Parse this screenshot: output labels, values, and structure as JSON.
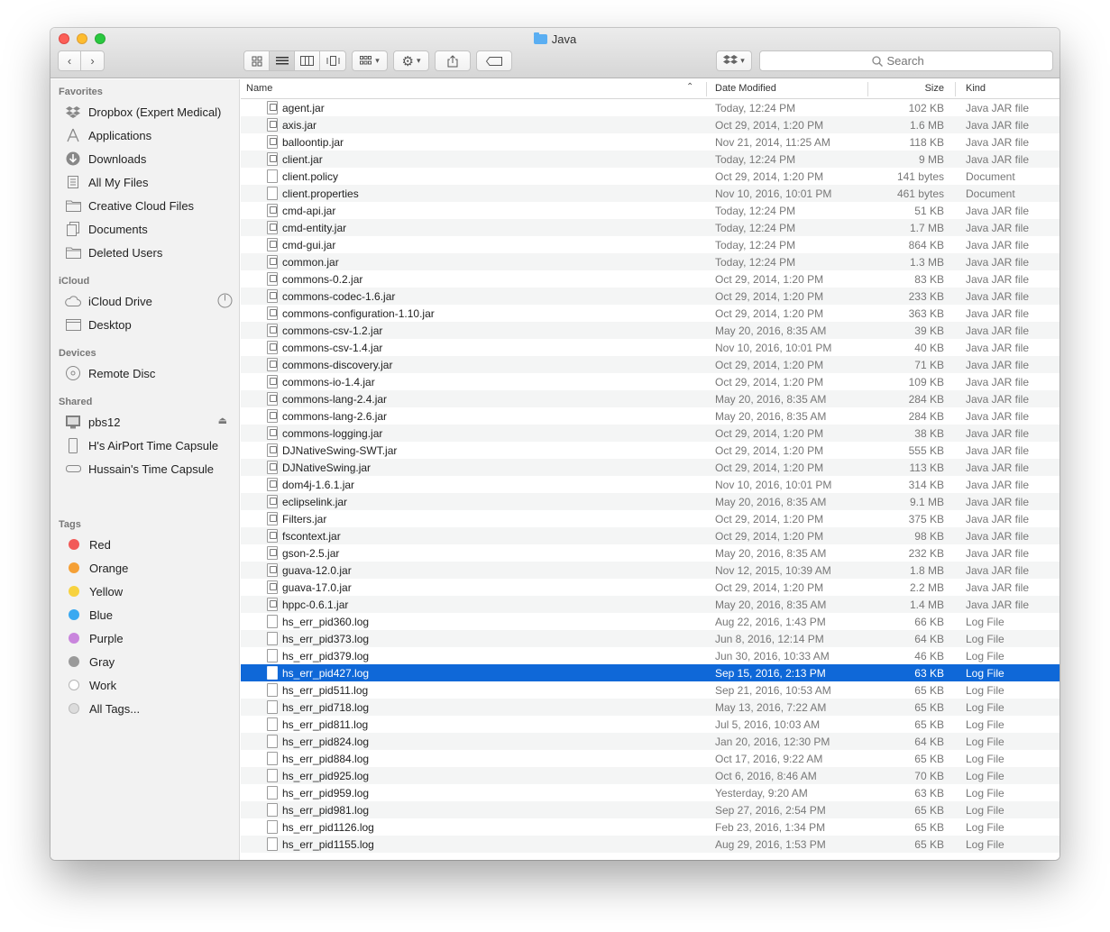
{
  "window": {
    "title": "Java"
  },
  "toolbar": {
    "search_placeholder": "Search"
  },
  "sidebar": {
    "favorites_heading": "Favorites",
    "favorites": [
      {
        "label": "Dropbox (Expert Medical)",
        "icon": "dropbox-icon"
      },
      {
        "label": "Applications",
        "icon": "applications-icon"
      },
      {
        "label": "Downloads",
        "icon": "downloads-icon"
      },
      {
        "label": "All My Files",
        "icon": "all-files-icon"
      },
      {
        "label": "Creative Cloud Files",
        "icon": "folder-icon"
      },
      {
        "label": "Documents",
        "icon": "documents-icon"
      },
      {
        "label": "Deleted Users",
        "icon": "folder-icon"
      }
    ],
    "icloud_heading": "iCloud",
    "icloud": [
      {
        "label": "iCloud Drive",
        "icon": "cloud-icon"
      },
      {
        "label": "Desktop",
        "icon": "desktop-icon"
      }
    ],
    "devices_heading": "Devices",
    "devices": [
      {
        "label": "Remote Disc",
        "icon": "disc-icon"
      }
    ],
    "shared_heading": "Shared",
    "shared": [
      {
        "label": "pbs12",
        "icon": "monitor-icon"
      },
      {
        "label": "H's AirPort Time Capsule",
        "icon": "time-capsule-icon"
      },
      {
        "label": "Hussain's Time Capsule",
        "icon": "time-capsule-icon"
      }
    ],
    "tags_heading": "Tags",
    "tags": [
      {
        "label": "Red",
        "color": "#f25a58"
      },
      {
        "label": "Orange",
        "color": "#f5a036"
      },
      {
        "label": "Yellow",
        "color": "#f7d23f"
      },
      {
        "label": "Blue",
        "color": "#3aa9f1"
      },
      {
        "label": "Purple",
        "color": "#c985dd"
      },
      {
        "label": "Gray",
        "color": "#9a9a9a"
      },
      {
        "label": "Work",
        "color": "#ffffff"
      },
      {
        "label": "All Tags...",
        "color": "#dcdcdc"
      }
    ]
  },
  "columns": {
    "name": "Name",
    "date": "Date Modified",
    "size": "Size",
    "kind": "Kind"
  },
  "files": [
    {
      "name": "agent.jar",
      "date": "Today, 12:24 PM",
      "size": "102 KB",
      "kind": "Java JAR file",
      "type": "jar"
    },
    {
      "name": "axis.jar",
      "date": "Oct 29, 2014, 1:20 PM",
      "size": "1.6 MB",
      "kind": "Java JAR file",
      "type": "jar"
    },
    {
      "name": "balloontip.jar",
      "date": "Nov 21, 2014, 11:25 AM",
      "size": "118 KB",
      "kind": "Java JAR file",
      "type": "jar"
    },
    {
      "name": "client.jar",
      "date": "Today, 12:24 PM",
      "size": "9 MB",
      "kind": "Java JAR file",
      "type": "jar"
    },
    {
      "name": "client.policy",
      "date": "Oct 29, 2014, 1:20 PM",
      "size": "141 bytes",
      "kind": "Document",
      "type": "doc"
    },
    {
      "name": "client.properties",
      "date": "Nov 10, 2016, 10:01 PM",
      "size": "461 bytes",
      "kind": "Document",
      "type": "doc"
    },
    {
      "name": "cmd-api.jar",
      "date": "Today, 12:24 PM",
      "size": "51 KB",
      "kind": "Java JAR file",
      "type": "jar"
    },
    {
      "name": "cmd-entity.jar",
      "date": "Today, 12:24 PM",
      "size": "1.7 MB",
      "kind": "Java JAR file",
      "type": "jar"
    },
    {
      "name": "cmd-gui.jar",
      "date": "Today, 12:24 PM",
      "size": "864 KB",
      "kind": "Java JAR file",
      "type": "jar"
    },
    {
      "name": "common.jar",
      "date": "Today, 12:24 PM",
      "size": "1.3 MB",
      "kind": "Java JAR file",
      "type": "jar"
    },
    {
      "name": "commons-0.2.jar",
      "date": "Oct 29, 2014, 1:20 PM",
      "size": "83 KB",
      "kind": "Java JAR file",
      "type": "jar"
    },
    {
      "name": "commons-codec-1.6.jar",
      "date": "Oct 29, 2014, 1:20 PM",
      "size": "233 KB",
      "kind": "Java JAR file",
      "type": "jar"
    },
    {
      "name": "commons-configuration-1.10.jar",
      "date": "Oct 29, 2014, 1:20 PM",
      "size": "363 KB",
      "kind": "Java JAR file",
      "type": "jar"
    },
    {
      "name": "commons-csv-1.2.jar",
      "date": "May 20, 2016, 8:35 AM",
      "size": "39 KB",
      "kind": "Java JAR file",
      "type": "jar"
    },
    {
      "name": "commons-csv-1.4.jar",
      "date": "Nov 10, 2016, 10:01 PM",
      "size": "40 KB",
      "kind": "Java JAR file",
      "type": "jar"
    },
    {
      "name": "commons-discovery.jar",
      "date": "Oct 29, 2014, 1:20 PM",
      "size": "71 KB",
      "kind": "Java JAR file",
      "type": "jar"
    },
    {
      "name": "commons-io-1.4.jar",
      "date": "Oct 29, 2014, 1:20 PM",
      "size": "109 KB",
      "kind": "Java JAR file",
      "type": "jar"
    },
    {
      "name": "commons-lang-2.4.jar",
      "date": "May 20, 2016, 8:35 AM",
      "size": "284 KB",
      "kind": "Java JAR file",
      "type": "jar"
    },
    {
      "name": "commons-lang-2.6.jar",
      "date": "May 20, 2016, 8:35 AM",
      "size": "284 KB",
      "kind": "Java JAR file",
      "type": "jar"
    },
    {
      "name": "commons-logging.jar",
      "date": "Oct 29, 2014, 1:20 PM",
      "size": "38 KB",
      "kind": "Java JAR file",
      "type": "jar"
    },
    {
      "name": "DJNativeSwing-SWT.jar",
      "date": "Oct 29, 2014, 1:20 PM",
      "size": "555 KB",
      "kind": "Java JAR file",
      "type": "jar"
    },
    {
      "name": "DJNativeSwing.jar",
      "date": "Oct 29, 2014, 1:20 PM",
      "size": "113 KB",
      "kind": "Java JAR file",
      "type": "jar"
    },
    {
      "name": "dom4j-1.6.1.jar",
      "date": "Nov 10, 2016, 10:01 PM",
      "size": "314 KB",
      "kind": "Java JAR file",
      "type": "jar"
    },
    {
      "name": "eclipselink.jar",
      "date": "May 20, 2016, 8:35 AM",
      "size": "9.1 MB",
      "kind": "Java JAR file",
      "type": "jar"
    },
    {
      "name": "Filters.jar",
      "date": "Oct 29, 2014, 1:20 PM",
      "size": "375 KB",
      "kind": "Java JAR file",
      "type": "jar"
    },
    {
      "name": "fscontext.jar",
      "date": "Oct 29, 2014, 1:20 PM",
      "size": "98 KB",
      "kind": "Java JAR file",
      "type": "jar"
    },
    {
      "name": "gson-2.5.jar",
      "date": "May 20, 2016, 8:35 AM",
      "size": "232 KB",
      "kind": "Java JAR file",
      "type": "jar"
    },
    {
      "name": "guava-12.0.jar",
      "date": "Nov 12, 2015, 10:39 AM",
      "size": "1.8 MB",
      "kind": "Java JAR file",
      "type": "jar"
    },
    {
      "name": "guava-17.0.jar",
      "date": "Oct 29, 2014, 1:20 PM",
      "size": "2.2 MB",
      "kind": "Java JAR file",
      "type": "jar"
    },
    {
      "name": "hppc-0.6.1.jar",
      "date": "May 20, 2016, 8:35 AM",
      "size": "1.4 MB",
      "kind": "Java JAR file",
      "type": "jar"
    },
    {
      "name": "hs_err_pid360.log",
      "date": "Aug 22, 2016, 1:43 PM",
      "size": "66 KB",
      "kind": "Log File",
      "type": "doc"
    },
    {
      "name": "hs_err_pid373.log",
      "date": "Jun 8, 2016, 12:14 PM",
      "size": "64 KB",
      "kind": "Log File",
      "type": "doc"
    },
    {
      "name": "hs_err_pid379.log",
      "date": "Jun 30, 2016, 10:33 AM",
      "size": "46 KB",
      "kind": "Log File",
      "type": "doc"
    },
    {
      "name": "hs_err_pid427.log",
      "date": "Sep 15, 2016, 2:13 PM",
      "size": "63 KB",
      "kind": "Log File",
      "type": "doc",
      "selected": true
    },
    {
      "name": "hs_err_pid511.log",
      "date": "Sep 21, 2016, 10:53 AM",
      "size": "65 KB",
      "kind": "Log File",
      "type": "doc"
    },
    {
      "name": "hs_err_pid718.log",
      "date": "May 13, 2016, 7:22 AM",
      "size": "65 KB",
      "kind": "Log File",
      "type": "doc"
    },
    {
      "name": "hs_err_pid811.log",
      "date": "Jul 5, 2016, 10:03 AM",
      "size": "65 KB",
      "kind": "Log File",
      "type": "doc"
    },
    {
      "name": "hs_err_pid824.log",
      "date": "Jan 20, 2016, 12:30 PM",
      "size": "64 KB",
      "kind": "Log File",
      "type": "doc"
    },
    {
      "name": "hs_err_pid884.log",
      "date": "Oct 17, 2016, 9:22 AM",
      "size": "65 KB",
      "kind": "Log File",
      "type": "doc"
    },
    {
      "name": "hs_err_pid925.log",
      "date": "Oct 6, 2016, 8:46 AM",
      "size": "70 KB",
      "kind": "Log File",
      "type": "doc"
    },
    {
      "name": "hs_err_pid959.log",
      "date": "Yesterday, 9:20 AM",
      "size": "63 KB",
      "kind": "Log File",
      "type": "doc"
    },
    {
      "name": "hs_err_pid981.log",
      "date": "Sep 27, 2016, 2:54 PM",
      "size": "65 KB",
      "kind": "Log File",
      "type": "doc"
    },
    {
      "name": "hs_err_pid1126.log",
      "date": "Feb 23, 2016, 1:34 PM",
      "size": "65 KB",
      "kind": "Log File",
      "type": "doc"
    },
    {
      "name": "hs_err_pid1155.log",
      "date": "Aug 29, 2016, 1:53 PM",
      "size": "65 KB",
      "kind": "Log File",
      "type": "doc"
    }
  ],
  "colors": {
    "selection": "#0f68d8",
    "sidebar_bg": "#f2f2f2"
  }
}
